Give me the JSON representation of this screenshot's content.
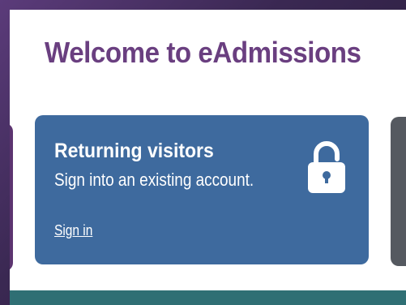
{
  "page": {
    "title": "Welcome to eAdmissions"
  },
  "cards": [
    {
      "title": "Returning visitors",
      "subtitle": "Sign into an existing account.",
      "link_label": "Sign in",
      "icon": "lock-icon"
    }
  ],
  "colors": {
    "title": "#6a3f80",
    "card_background": "#3e6a9e",
    "left_card": "#5c3470",
    "right_card": "#555960",
    "bottom_band": "#2f6f74"
  }
}
